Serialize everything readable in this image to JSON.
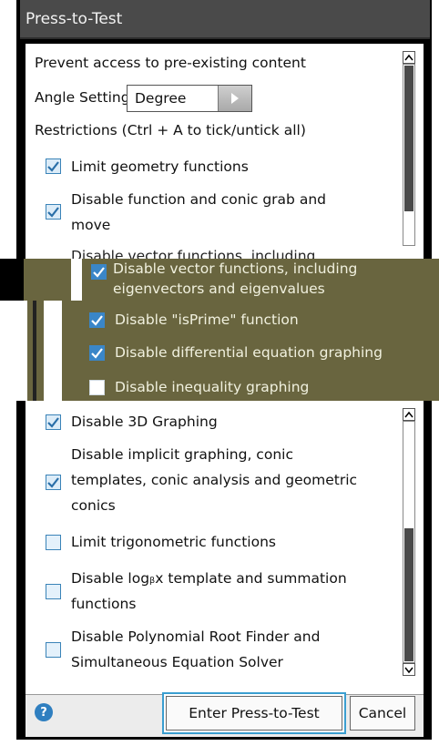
{
  "dialog": {
    "title": "Press-to-Test",
    "prevent_access": "Prevent access to pre-existing content",
    "angle_label": "Angle Setting:",
    "angle_value": "Degree",
    "restrictions_label": "Restrictions (Ctrl + A to tick/untick all)"
  },
  "restrictions_top": [
    {
      "lines": [
        "Limit geometry functions"
      ],
      "checked": true
    },
    {
      "lines": [
        "Disable function and conic grab and",
        "move"
      ],
      "checked": true
    },
    {
      "lines": [
        "Disable vector functions, including"
      ],
      "checked": false
    }
  ],
  "overlay_items": [
    {
      "lines": [
        "Disable vector functions, including",
        "eigenvectors and eigenvalues"
      ],
      "checked": true
    },
    {
      "lines": [
        "Disable \"isPrime\" function"
      ],
      "checked": true
    },
    {
      "lines": [
        "Disable differential equation graphing"
      ],
      "checked": true
    },
    {
      "lines": [
        "Disable inequality graphing"
      ],
      "checked": false
    }
  ],
  "restrictions_bottom": [
    {
      "lines": [
        "Disable 3D Graphing"
      ],
      "checked": true
    },
    {
      "lines": [
        "Disable implicit graphing, conic",
        "templates, conic analysis and geometric",
        "conics"
      ],
      "checked": true
    },
    {
      "lines": [
        "Limit trigonometric functions"
      ],
      "checked": false
    },
    {
      "lines": [
        "Disable logᵦx template and summation",
        "functions"
      ],
      "checked": false
    },
    {
      "lines": [
        "Disable Polynomial Root Finder and",
        "Simultaneous Equation Solver"
      ],
      "checked": false
    }
  ],
  "footer": {
    "help_glyph": "?",
    "enter_label": "Enter Press-to-Test",
    "cancel_label": "Cancel"
  },
  "colors": {
    "accent": "#3a83b8",
    "overlay": "#69653f",
    "titlebar": "#4a4a4a"
  }
}
